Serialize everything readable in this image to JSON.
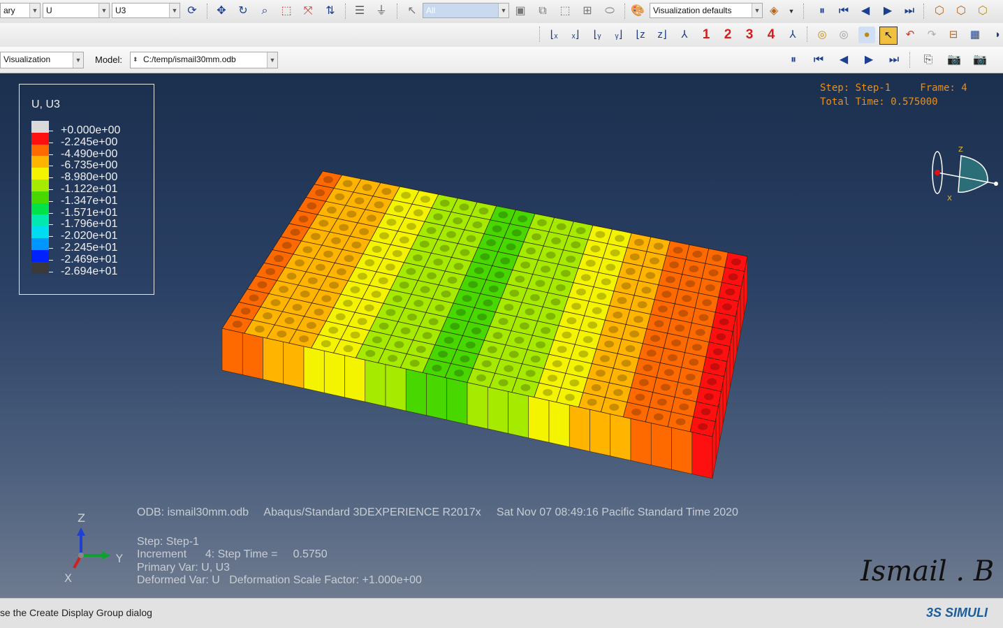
{
  "toolbar": {
    "combo_library": "ary",
    "combo_var": "U",
    "combo_comp": "U3",
    "combo_select": "All",
    "combo_vis": "Visualization defaults"
  },
  "csys_buttons": [
    "1",
    "2",
    "3",
    "4"
  ],
  "context": {
    "module_value": "Visualization",
    "model_label": "Model:",
    "model_value": "C:/temp/ismail30mm.odb"
  },
  "legend": {
    "title": "U, U3",
    "entries": [
      {
        "value": "+0.000e+00",
        "color": "#d9d9d9"
      },
      {
        "value": "-2.245e+00",
        "color": "#ff1010"
      },
      {
        "value": "-4.490e+00",
        "color": "#ff6a00"
      },
      {
        "value": "-6.735e+00",
        "color": "#ffb400"
      },
      {
        "value": "-8.980e+00",
        "color": "#f4f400"
      },
      {
        "value": "-1.122e+01",
        "color": "#a6ea00"
      },
      {
        "value": "-1.347e+01",
        "color": "#48d800"
      },
      {
        "value": "-1.571e+01",
        "color": "#00e24a"
      },
      {
        "value": "-1.796e+01",
        "color": "#00eab0"
      },
      {
        "value": "-2.020e+01",
        "color": "#00dcf0"
      },
      {
        "value": "-2.245e+01",
        "color": "#0096ff"
      },
      {
        "value": "-2.469e+01",
        "color": "#0022ff"
      },
      {
        "value": "-2.694e+01",
        "color": "#3a3a3a"
      }
    ]
  },
  "step_info": {
    "line1": "Step: Step-1     Frame: 4",
    "line2": "Total Time: 0.575000"
  },
  "view_info": {
    "odb_line": "ODB: ismail30mm.odb     Abaqus/Standard 3DEXPERIENCE R2017x     Sat Nov 07 08:49:16 Pacific Standard Time 2020",
    "step_line": "Step: Step-1",
    "increment_line": "Increment      4: Step Time =     0.5750",
    "primary_line": "Primary Var: U, U3",
    "deformed_line": "Deformed Var: U   Deformation Scale Factor: +1.000e+00"
  },
  "triad": {
    "z": "Z",
    "y": "Y",
    "x": "X"
  },
  "signature": "Ismail . B",
  "status": {
    "text": "se the Create Display Group dialog",
    "brand": "3S SIMULI"
  }
}
